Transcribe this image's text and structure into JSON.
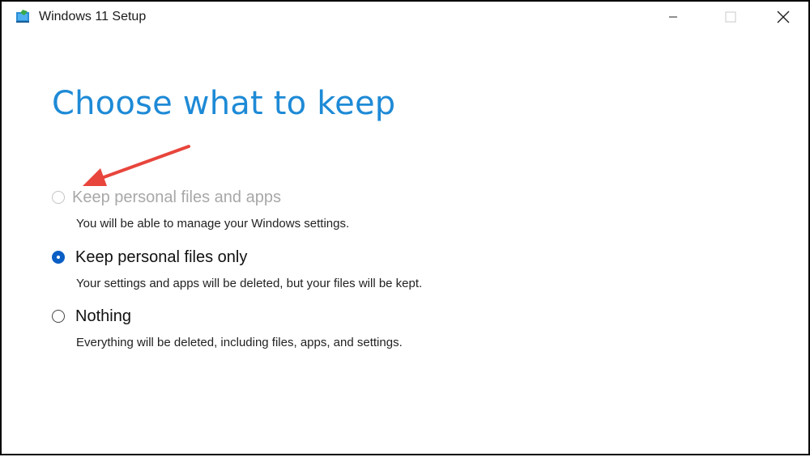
{
  "window": {
    "title": "Windows 11 Setup"
  },
  "page": {
    "heading": "Choose what to keep"
  },
  "options": [
    {
      "label": "Keep personal files and apps",
      "description": "You will be able to manage your Windows settings.",
      "selected": false,
      "disabled": true
    },
    {
      "label": "Keep personal files only",
      "description": "Your settings and apps will be deleted, but your files will be kept.",
      "selected": true,
      "disabled": false
    },
    {
      "label": "Nothing",
      "description": "Everything will be deleted, including files, apps, and settings.",
      "selected": false,
      "disabled": false
    }
  ],
  "colors": {
    "heading": "#1e8ad6",
    "radio_selected": "#0a5ec4",
    "annotation_arrow": "#e8453c",
    "disabled_text": "#a8a8a8"
  },
  "icons": {
    "app": "windows-setup-icon",
    "minimize": "minimize-icon",
    "maximize": "maximize-icon",
    "close": "close-icon",
    "annotation": "red-arrow-annotation"
  }
}
